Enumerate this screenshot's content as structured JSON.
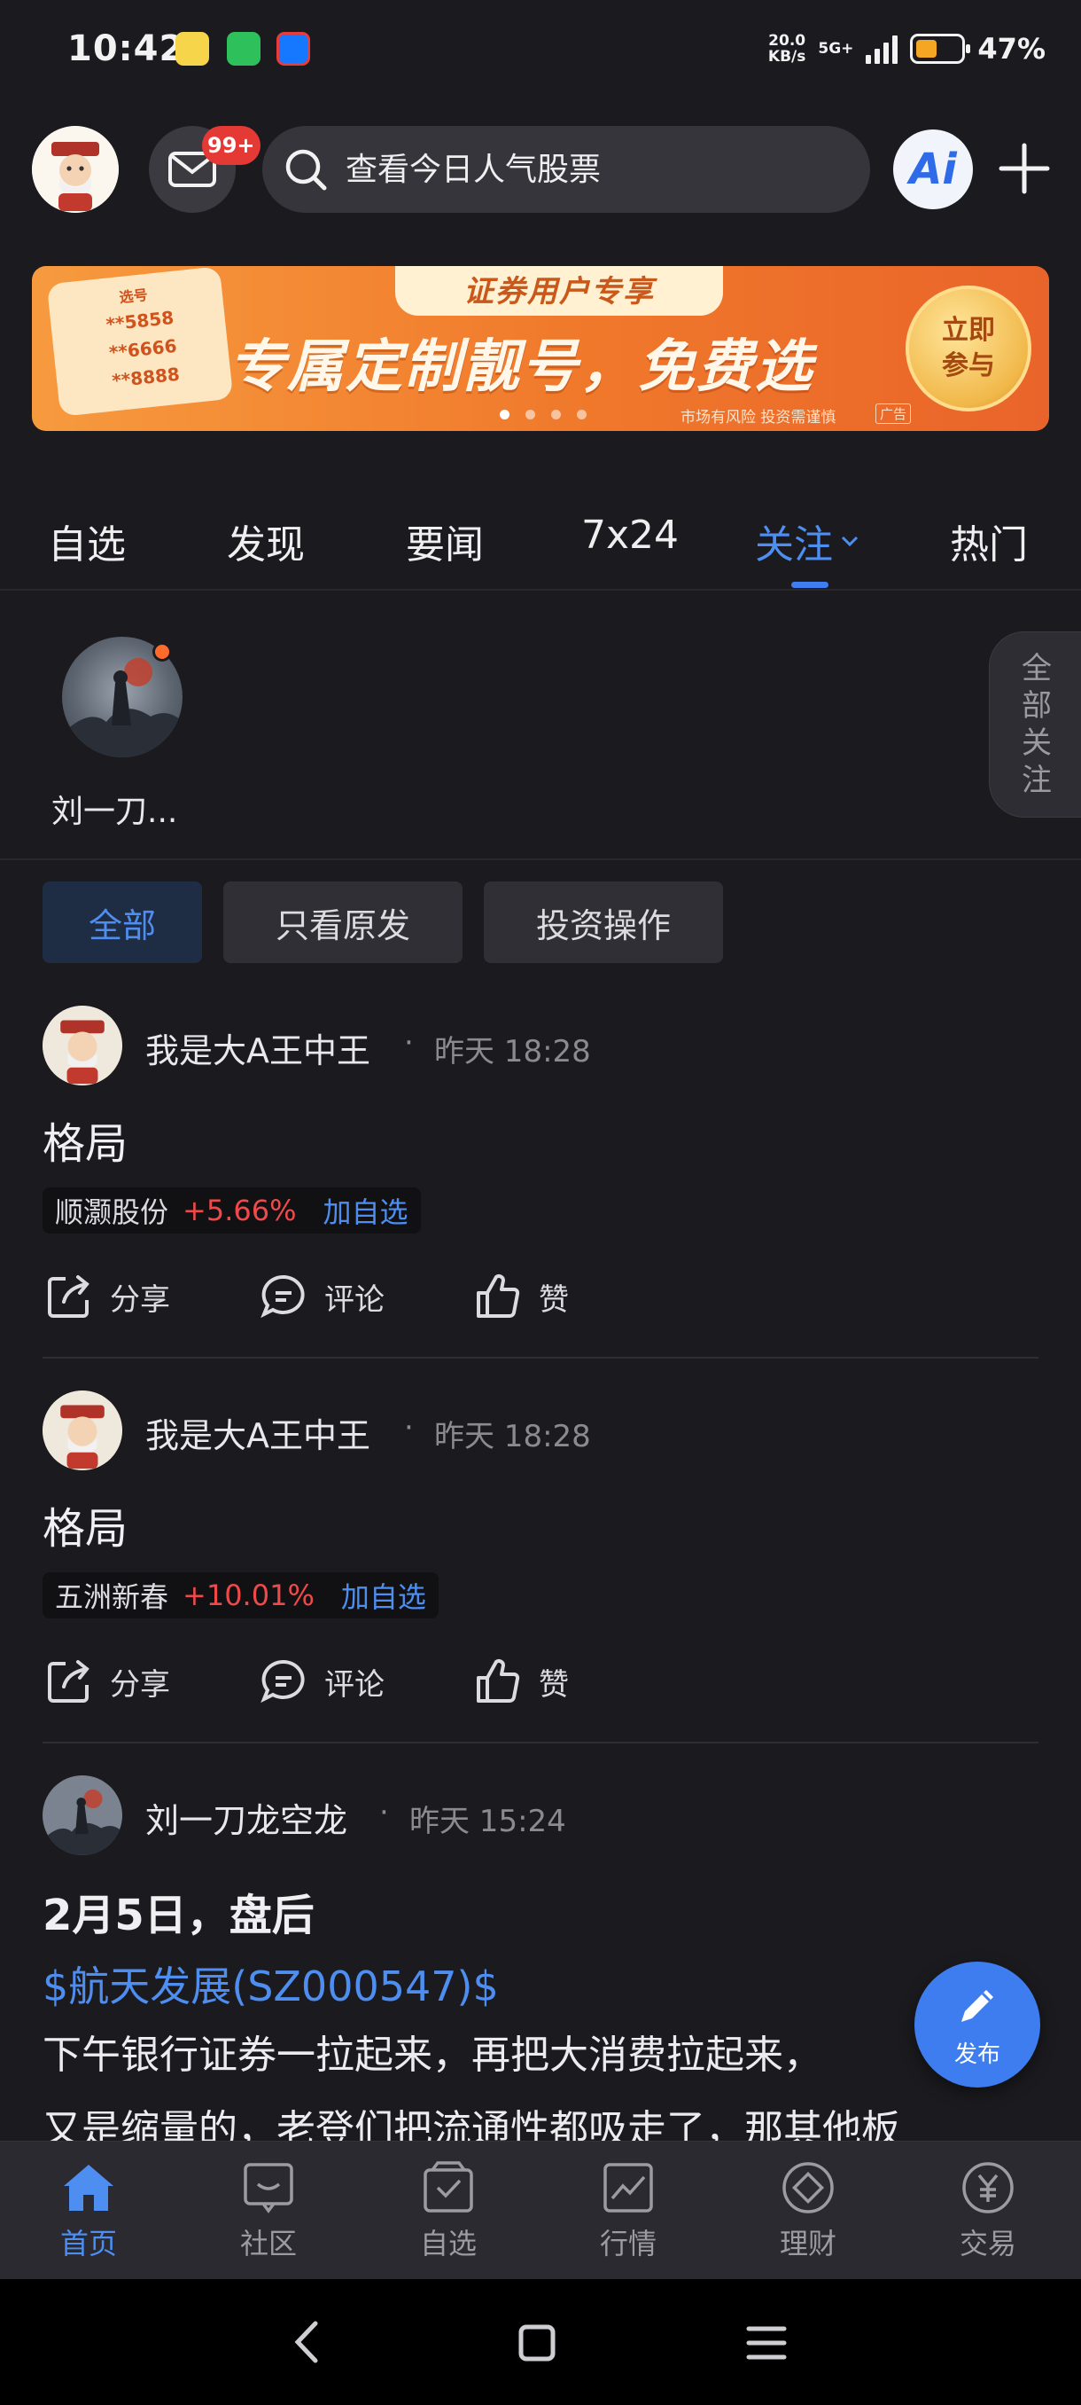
{
  "status_bar": {
    "time": "10:42",
    "net_speed": "20.0",
    "net_unit": "KB/s",
    "network": "5G+",
    "battery": "47%",
    "battery_level": 0.47
  },
  "header": {
    "message_badge": "99+",
    "search_placeholder": "查看今日人气股票",
    "ai_label": "Ai"
  },
  "banner": {
    "tag": "证券用户专享",
    "headline": "专属定制靓号，免费选",
    "cta": "立即参与",
    "ticket_top": "选号",
    "ticket_numbers": [
      "**5858",
      "**6666",
      "**8888"
    ],
    "risk_text": "市场有风险 投资需谨慎",
    "ad_label": "广告"
  },
  "tabs": [
    {
      "label": "自选",
      "active": false
    },
    {
      "label": "发现",
      "active": false
    },
    {
      "label": "要闻",
      "active": false
    },
    {
      "label": "7x24",
      "active": false
    },
    {
      "label": "关注",
      "active": true
    },
    {
      "label": "热门",
      "active": false
    }
  ],
  "following": {
    "users": [
      {
        "name": "刘一刀..."
      }
    ],
    "all_label": "全部关注"
  },
  "filters": [
    {
      "label": "全部",
      "active": true
    },
    {
      "label": "只看原发",
      "active": false
    },
    {
      "label": "投资操作",
      "active": false
    }
  ],
  "posts": [
    {
      "author": "我是大A王中王",
      "time": "昨天 18:28",
      "title": "格局",
      "stock": {
        "name": "顺灏股份",
        "change": "+5.66%",
        "add_label": "加自选"
      },
      "actions": {
        "share": "分享",
        "comment": "评论",
        "like": "赞"
      }
    },
    {
      "author": "我是大A王中王",
      "time": "昨天 18:28",
      "title": "格局",
      "stock": {
        "name": "五洲新春",
        "change": "+10.01%",
        "add_label": "加自选"
      },
      "actions": {
        "share": "分享",
        "comment": "评论",
        "like": "赞"
      }
    },
    {
      "author": "刘一刀龙空龙",
      "time": "昨天 15:24",
      "title": "2月5日，盘后",
      "link": "$航天发展(SZ000547)$",
      "body_line1": "下午银行证券一拉起来，再把大消费拉起来，",
      "body_line2": "又是缩量的，老登们把流通性都吸走了，那其他板"
    }
  ],
  "fab_label": "发布",
  "bottom_nav": [
    {
      "label": "首页",
      "icon": "home-icon",
      "active": true
    },
    {
      "label": "社区",
      "icon": "community-icon",
      "active": false
    },
    {
      "label": "自选",
      "icon": "watchlist-icon",
      "active": false
    },
    {
      "label": "行情",
      "icon": "market-icon",
      "active": false
    },
    {
      "label": "理财",
      "icon": "wealth-icon",
      "active": false
    },
    {
      "label": "交易",
      "icon": "trade-icon",
      "active": false
    }
  ],
  "colors": {
    "accent": "#4d8ef0",
    "up": "#ef4a4a",
    "background": "#1b1b1f"
  }
}
